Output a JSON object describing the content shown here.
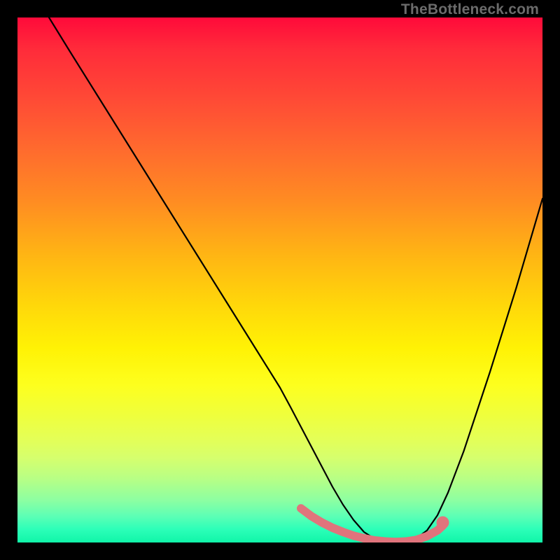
{
  "watermark": "TheBottleneck.com",
  "chart_data": {
    "type": "line",
    "title": "",
    "xlabel": "",
    "ylabel": "",
    "xlim": [
      0,
      100
    ],
    "ylim": [
      0,
      100
    ],
    "grid": false,
    "series": [
      {
        "name": "bottleneck-curve",
        "color": "#000000",
        "x": [
          6,
          10,
          15,
          20,
          25,
          30,
          35,
          40,
          45,
          50,
          52,
          54,
          56,
          58,
          60,
          62,
          64,
          66,
          68,
          70,
          72,
          74,
          76,
          78,
          80,
          82,
          85,
          90,
          95,
          100
        ],
        "y": [
          100,
          93.5,
          85.5,
          77.5,
          69.5,
          61.5,
          53.5,
          45.5,
          37.5,
          29.5,
          25.8,
          22.0,
          18.2,
          14.4,
          10.6,
          7.2,
          4.3,
          2.0,
          0.7,
          0.2,
          0.1,
          0.2,
          0.8,
          2.3,
          5.2,
          9.5,
          17.4,
          32.5,
          48.5,
          65.5
        ]
      },
      {
        "name": "highlight-segment",
        "color": "#e0747c",
        "x": [
          54,
          56,
          58,
          60,
          62,
          64,
          66,
          68,
          70,
          72,
          74,
          76,
          78,
          80,
          81
        ],
        "y": [
          6.5,
          5.0,
          3.8,
          2.8,
          2.0,
          1.3,
          0.8,
          0.4,
          0.2,
          0.1,
          0.2,
          0.5,
          1.2,
          2.3,
          3.2
        ]
      }
    ],
    "marker": {
      "name": "highlight-dot",
      "x": 81,
      "y": 3.8,
      "color": "#e0747c"
    }
  }
}
